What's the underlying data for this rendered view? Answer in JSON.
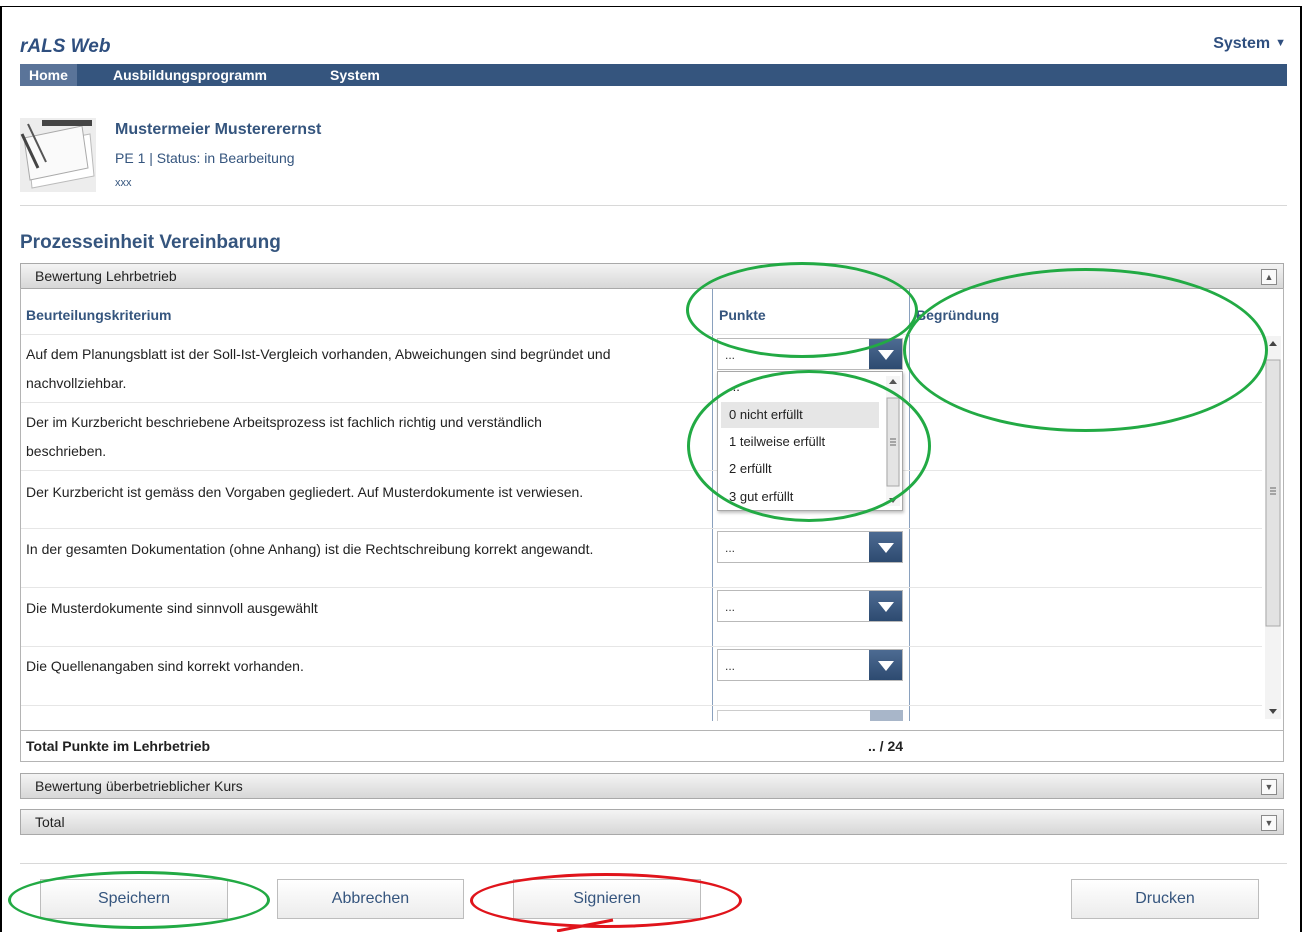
{
  "app": {
    "title": "rALS Web",
    "system_menu": "System"
  },
  "nav": {
    "items": [
      {
        "label": "Home"
      },
      {
        "label": "Ausbildungsprogramm"
      },
      {
        "label": "System"
      }
    ]
  },
  "person": {
    "name": "Mustermeier Mustererernst",
    "status_line": "PE 1 | Status: in Bearbeitung",
    "sub": "xxx"
  },
  "section": {
    "title": "Prozesseinheit Vereinbarung"
  },
  "panel_lehrbetrieb": {
    "title": "Bewertung Lehrbetrieb",
    "columns": {
      "criterion": "Beurteilungskriterium",
      "points": "Punkte",
      "reason": "Begründung"
    },
    "rows": [
      {
        "line1": "Auf dem Planungsblatt ist der Soll-Ist-Vergleich vorhanden, Abweichungen sind begründet und",
        "line2": "nachvollziehbar.",
        "value": "..."
      },
      {
        "line1": "Der im Kurzbericht beschriebene Arbeitsprozess ist fachlich richtig und verständlich",
        "line2": "beschrieben.",
        "value": "..."
      },
      {
        "line1": "Der Kurzbericht ist gemäss den Vorgaben gegliedert. Auf Musterdokumente ist verwiesen.",
        "line2": "",
        "value": "..."
      },
      {
        "line1": "In der gesamten Dokumentation (ohne Anhang) ist die Rechtschreibung korrekt angewandt.",
        "line2": "",
        "value": "..."
      },
      {
        "line1": "Die Musterdokumente sind sinnvoll ausgewählt",
        "line2": "",
        "value": "..."
      },
      {
        "line1": "Die Quellenangaben sind korrekt vorhanden.",
        "line2": "",
        "value": "..."
      }
    ],
    "dropdown_options": [
      "...",
      "0 nicht erfüllt",
      "1 teilweise erfüllt",
      "2 erfüllt",
      "3 gut erfüllt"
    ],
    "total_label": "Total Punkte im Lehrbetrieb",
    "total_value": ".. / 24"
  },
  "panel_kurs": {
    "title": "Bewertung überbetrieblicher Kurs"
  },
  "panel_total": {
    "title": "Total"
  },
  "buttons": {
    "save": "Speichern",
    "cancel": "Abbrechen",
    "sign": "Signieren",
    "print": "Drucken"
  },
  "annotation_colors": {
    "green": "#22aa44",
    "red": "#e0141b"
  }
}
